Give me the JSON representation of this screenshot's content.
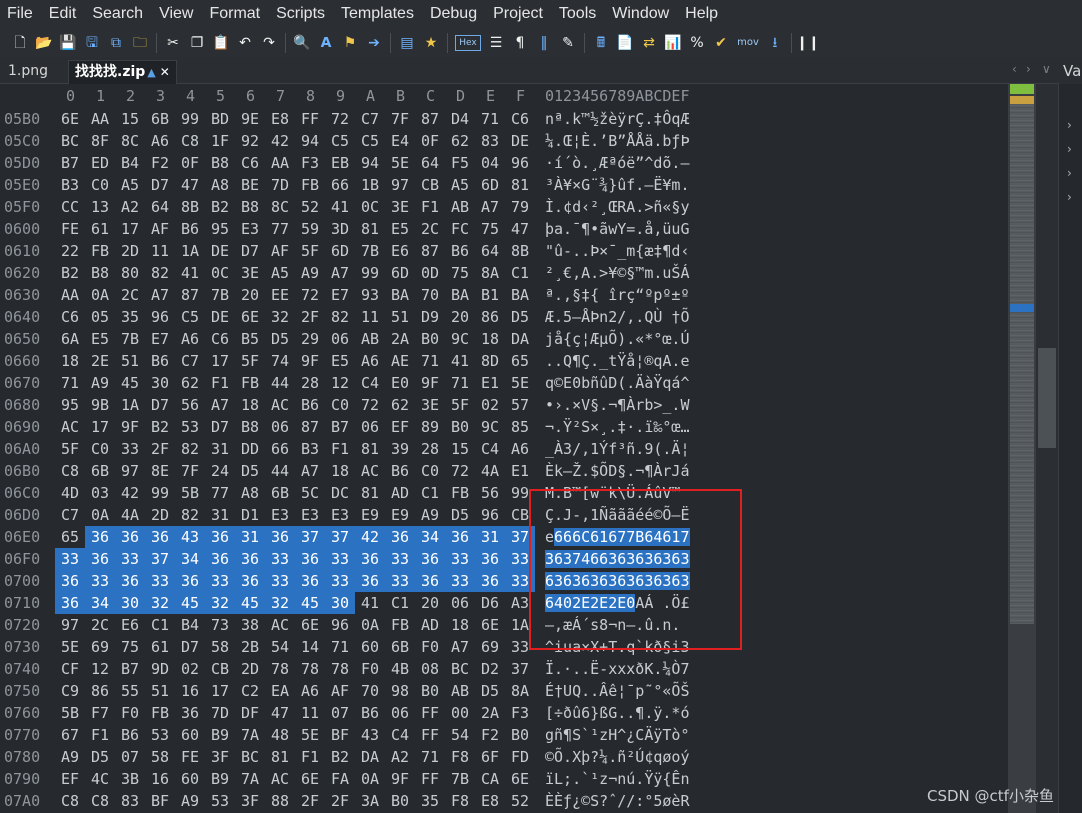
{
  "menu": [
    "File",
    "Edit",
    "Search",
    "View",
    "Format",
    "Scripts",
    "Templates",
    "Debug",
    "Project",
    "Tools",
    "Window",
    "Help"
  ],
  "toolbar": {
    "hex_label": "Hex",
    "mov_label": "mov"
  },
  "tabs": [
    {
      "label": "1.png",
      "active": false
    },
    {
      "label": "找找找.zip",
      "active": true
    }
  ],
  "right_panel_title": "Va",
  "hex_header": [
    "0",
    "1",
    "2",
    "3",
    "4",
    "5",
    "6",
    "7",
    "8",
    "9",
    "A",
    "B",
    "C",
    "D",
    "E",
    "F"
  ],
  "ascii_header": "0123456789ABCDEF",
  "rows": [
    {
      "addr": "05B0",
      "bytes": [
        "6E",
        "AA",
        "15",
        "6B",
        "99",
        "BD",
        "9E",
        "E8",
        "FF",
        "72",
        "C7",
        "7F",
        "87",
        "D4",
        "71",
        "C6"
      ],
      "ascii": "nª.k™½žèÿrÇ.‡ÔqÆ"
    },
    {
      "addr": "05C0",
      "bytes": [
        "BC",
        "8F",
        "8C",
        "A6",
        "C8",
        "1F",
        "92",
        "42",
        "94",
        "C5",
        "C5",
        "E4",
        "0F",
        "62",
        "83",
        "DE"
      ],
      "ascii": "¼.Œ¦È.’B”ÅÅä.bƒÞ"
    },
    {
      "addr": "05D0",
      "bytes": [
        "B7",
        "ED",
        "B4",
        "F2",
        "0F",
        "B8",
        "C6",
        "AA",
        "F3",
        "EB",
        "94",
        "5E",
        "64",
        "F5",
        "04",
        "96"
      ],
      "ascii": "·í´ò.¸Æªóë”^dõ.–"
    },
    {
      "addr": "05E0",
      "bytes": [
        "B3",
        "C0",
        "A5",
        "D7",
        "47",
        "A8",
        "BE",
        "7D",
        "FB",
        "66",
        "1B",
        "97",
        "CB",
        "A5",
        "6D",
        "81"
      ],
      "ascii": "³À¥×G¨¾}ûf.—Ë¥m."
    },
    {
      "addr": "05F0",
      "bytes": [
        "CC",
        "13",
        "A2",
        "64",
        "8B",
        "B2",
        "B8",
        "8C",
        "52",
        "41",
        "0C",
        "3E",
        "F1",
        "AB",
        "A7",
        "79"
      ],
      "ascii": "Ì.¢d‹²¸ŒRA.>ñ«§y"
    },
    {
      "addr": "0600",
      "bytes": [
        "FE",
        "61",
        "17",
        "AF",
        "B6",
        "95",
        "E3",
        "77",
        "59",
        "3D",
        "81",
        "E5",
        "2C",
        "FC",
        "75",
        "47"
      ],
      "ascii": "þa.¯¶•ãwY=.å,üuG"
    },
    {
      "addr": "0610",
      "bytes": [
        "22",
        "FB",
        "2D",
        "11",
        "1A",
        "DE",
        "D7",
        "AF",
        "5F",
        "6D",
        "7B",
        "E6",
        "87",
        "B6",
        "64",
        "8B"
      ],
      "ascii": "\"û-..Þ×¯_m{æ‡¶d‹"
    },
    {
      "addr": "0620",
      "bytes": [
        "B2",
        "B8",
        "80",
        "82",
        "41",
        "0C",
        "3E",
        "A5",
        "A9",
        "A7",
        "99",
        "6D",
        "0D",
        "75",
        "8A",
        "C1"
      ],
      "ascii": "²¸€‚A.>¥©§™m.uŠÁ"
    },
    {
      "addr": "0630",
      "bytes": [
        "AA",
        "0A",
        "2C",
        "A7",
        "87",
        "7B",
        "20",
        "EE",
        "72",
        "E7",
        "93",
        "BA",
        "70",
        "BA",
        "B1",
        "BA"
      ],
      "ascii": "ª.,§‡{ îrç“ºpº±º"
    },
    {
      "addr": "0640",
      "bytes": [
        "C6",
        "05",
        "35",
        "96",
        "C5",
        "DE",
        "6E",
        "32",
        "2F",
        "82",
        "11",
        "51",
        "D9",
        "20",
        "86",
        "D5"
      ],
      "ascii": "Æ.5–ÅÞn2/‚.QÙ †Õ"
    },
    {
      "addr": "0650",
      "bytes": [
        "6A",
        "E5",
        "7B",
        "E7",
        "A6",
        "C6",
        "B5",
        "D5",
        "29",
        "06",
        "AB",
        "2A",
        "B0",
        "9C",
        "18",
        "DA"
      ],
      "ascii": "jå{ç¦ÆµÕ).«*°œ.Ú"
    },
    {
      "addr": "0660",
      "bytes": [
        "18",
        "2E",
        "51",
        "B6",
        "C7",
        "17",
        "5F",
        "74",
        "9F",
        "E5",
        "A6",
        "AE",
        "71",
        "41",
        "8D",
        "65"
      ],
      "ascii": "..Q¶Ç._tŸå¦®qA.e"
    },
    {
      "addr": "0670",
      "bytes": [
        "71",
        "A9",
        "45",
        "30",
        "62",
        "F1",
        "FB",
        "44",
        "28",
        "12",
        "C4",
        "E0",
        "9F",
        "71",
        "E1",
        "5E"
      ],
      "ascii": "q©E0bñûD(.ÄàŸqá^"
    },
    {
      "addr": "0680",
      "bytes": [
        "95",
        "9B",
        "1A",
        "D7",
        "56",
        "A7",
        "18",
        "AC",
        "B6",
        "C0",
        "72",
        "62",
        "3E",
        "5F",
        "02",
        "57"
      ],
      "ascii": "•›.×V§.¬¶Àrb>_.W"
    },
    {
      "addr": "0690",
      "bytes": [
        "AC",
        "17",
        "9F",
        "B2",
        "53",
        "D7",
        "B8",
        "06",
        "87",
        "B7",
        "06",
        "EF",
        "89",
        "B0",
        "9C",
        "85"
      ],
      "ascii": "¬.Ÿ²S×¸.‡·.ï‰°œ…"
    },
    {
      "addr": "06A0",
      "bytes": [
        "5F",
        "C0",
        "33",
        "2F",
        "82",
        "31",
        "DD",
        "66",
        "B3",
        "F1",
        "81",
        "39",
        "28",
        "15",
        "C4",
        "A6"
      ],
      "ascii": "_À3/‚1Ýf³ñ.9(.Ä¦"
    },
    {
      "addr": "06B0",
      "bytes": [
        "C8",
        "6B",
        "97",
        "8E",
        "7F",
        "24",
        "D5",
        "44",
        "A7",
        "18",
        "AC",
        "B6",
        "C0",
        "72",
        "4A",
        "E1"
      ],
      "ascii": "Èk—Ž.$ÕD§.¬¶ÀrJá"
    },
    {
      "addr": "06C0",
      "bytes": [
        "4D",
        "03",
        "42",
        "99",
        "5B",
        "77",
        "A8",
        "6B",
        "5C",
        "DC",
        "81",
        "AD",
        "C1",
        "FB",
        "56",
        "99"
      ],
      "ascii": "M.B™[w¨k\\Ü.­ÁûV™"
    },
    {
      "addr": "06D0",
      "bytes": [
        "C7",
        "0A",
        "4A",
        "2D",
        "82",
        "31",
        "D1",
        "E3",
        "E3",
        "E3",
        "E9",
        "E9",
        "A9",
        "D5",
        "96",
        "CB"
      ],
      "ascii": "Ç.J-‚1Ñãããéé©Õ–Ë"
    },
    {
      "addr": "06E0",
      "bytes": [
        "65",
        "36",
        "36",
        "36",
        "43",
        "36",
        "31",
        "36",
        "37",
        "37",
        "42",
        "36",
        "34",
        "36",
        "31",
        "37"
      ],
      "ascii": "e666C61677B64617",
      "sel_from": 1
    },
    {
      "addr": "06F0",
      "bytes": [
        "33",
        "36",
        "33",
        "37",
        "34",
        "36",
        "36",
        "33",
        "36",
        "33",
        "36",
        "33",
        "36",
        "33",
        "36",
        "33"
      ],
      "ascii": "3637466363636363",
      "sel_from": 0
    },
    {
      "addr": "0700",
      "bytes": [
        "36",
        "33",
        "36",
        "33",
        "36",
        "33",
        "36",
        "33",
        "36",
        "33",
        "36",
        "33",
        "36",
        "33",
        "36",
        "33"
      ],
      "ascii": "6363636363636363",
      "sel_from": 0
    },
    {
      "addr": "0710",
      "bytes": [
        "36",
        "34",
        "30",
        "32",
        "45",
        "32",
        "45",
        "32",
        "45",
        "30",
        "41",
        "C1",
        "20",
        "06",
        "D6",
        "A3"
      ],
      "ascii": "6402E2E2E0AÁ .Ö£",
      "sel_from": 0,
      "sel_to": 9
    },
    {
      "addr": "0720",
      "bytes": [
        "97",
        "2C",
        "E6",
        "C1",
        "B4",
        "73",
        "38",
        "AC",
        "6E",
        "96",
        "0A",
        "FB",
        "AD",
        "18",
        "6E",
        "1A"
      ],
      "ascii": "—,æÁ´s8¬n–.û­.n."
    },
    {
      "addr": "0730",
      "bytes": [
        "5E",
        "69",
        "75",
        "61",
        "D7",
        "58",
        "2B",
        "54",
        "14",
        "71",
        "60",
        "6B",
        "F0",
        "A7",
        "69",
        "33"
      ],
      "ascii": "^iua×X+T.q`kð§i3"
    },
    {
      "addr": "0740",
      "bytes": [
        "CF",
        "12",
        "B7",
        "9D",
        "02",
        "CB",
        "2D",
        "78",
        "78",
        "78",
        "F0",
        "4B",
        "08",
        "BC",
        "D2",
        "37"
      ],
      "ascii": "Ï.·..Ë-xxxðK.¼Ò7"
    },
    {
      "addr": "0750",
      "bytes": [
        "C9",
        "86",
        "55",
        "51",
        "16",
        "17",
        "C2",
        "EA",
        "A6",
        "AF",
        "70",
        "98",
        "B0",
        "AB",
        "D5",
        "8A"
      ],
      "ascii": "É†UQ..Âê¦¯p˜°«ÕŠ"
    },
    {
      "addr": "0760",
      "bytes": [
        "5B",
        "F7",
        "F0",
        "FB",
        "36",
        "7D",
        "DF",
        "47",
        "11",
        "07",
        "B6",
        "06",
        "FF",
        "00",
        "2A",
        "F3"
      ],
      "ascii": "[÷ðû6}ßG..¶.ÿ.*ó"
    },
    {
      "addr": "0770",
      "bytes": [
        "67",
        "F1",
        "B6",
        "53",
        "60",
        "B9",
        "7A",
        "48",
        "5E",
        "BF",
        "43",
        "C4",
        "FF",
        "54",
        "F2",
        "B0"
      ],
      "ascii": "gñ¶S`¹zH^¿CÄÿTò°"
    },
    {
      "addr": "0780",
      "bytes": [
        "A9",
        "D5",
        "07",
        "58",
        "FE",
        "3F",
        "BC",
        "81",
        "F1",
        "B2",
        "DA",
        "A2",
        "71",
        "F8",
        "6F",
        "FD"
      ],
      "ascii": "©Õ.Xþ?¼.ñ²Ú¢qøoý"
    },
    {
      "addr": "0790",
      "bytes": [
        "EF",
        "4C",
        "3B",
        "16",
        "60",
        "B9",
        "7A",
        "AC",
        "6E",
        "FA",
        "0A",
        "9F",
        "FF",
        "7B",
        "CA",
        "6E"
      ],
      "ascii": "ïL;.`¹z¬nú.Ÿÿ{Ên"
    },
    {
      "addr": "07A0",
      "bytes": [
        "C8",
        "C8",
        "83",
        "BF",
        "A9",
        "53",
        "3F",
        "88",
        "2F",
        "2F",
        "3A",
        "B0",
        "35",
        "F8",
        "E8",
        "52"
      ],
      "ascii": "ÈÈƒ¿©S?ˆ//:°5øèR"
    }
  ],
  "watermark": "CSDN @ctf小杂鱼"
}
